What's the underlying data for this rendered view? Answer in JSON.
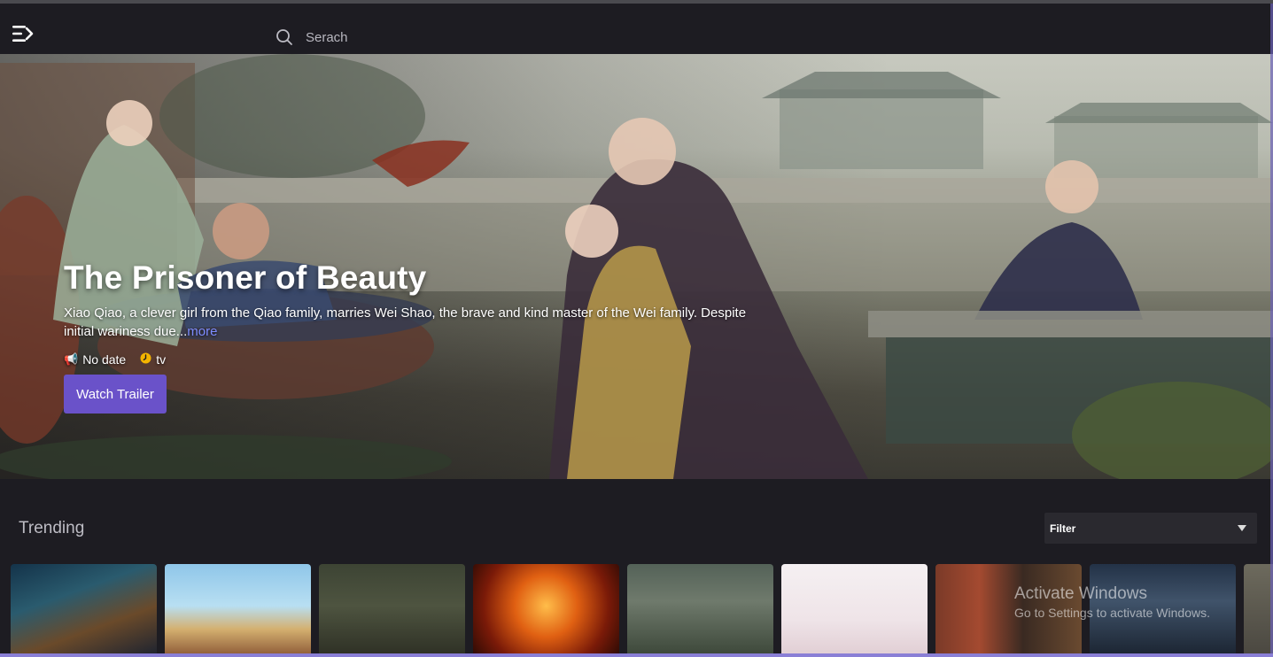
{
  "header": {
    "search_placeholder": "Serach"
  },
  "hero": {
    "title": "The Prisoner of Beauty",
    "description": "Xiao Qiao, a clever girl from the Qiao family, marries Wei Shao, the brave and kind master of the Wei family. Despite initial wariness due...",
    "more_label": "more",
    "date_label": "No date",
    "date_icon": "megaphone-icon",
    "type_label": "tv",
    "type_icon": "clock-icon",
    "trailer_button": "Watch Trailer",
    "accent_color": "#6a52c9"
  },
  "trending": {
    "title": "Trending",
    "filter_label": "Filter",
    "card_count_visible": 9
  },
  "watermark": {
    "line1": "Activate Windows",
    "line2": "Go to Settings to activate Windows."
  }
}
